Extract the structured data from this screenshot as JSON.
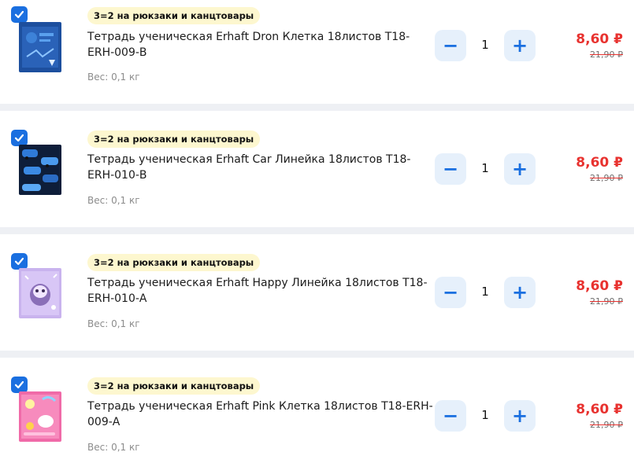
{
  "cart_items": [
    {
      "promo": "3=2 на рюкзаки и канцтовары",
      "title": "Тетрадь ученическая Erhaft Dron Клетка 18листов Т18-ERH-009-В",
      "weight": "Вес: 0,1 кг",
      "quantity": "1",
      "price": "8,60 ₽",
      "old_price": "21,90 ₽",
      "thumbnail": "notebook-blue-drone-cover",
      "checked": true
    },
    {
      "promo": "3=2 на рюкзаки и канцтовары",
      "title": "Тетрадь ученическая Erhaft Car Линейка 18листов Т18-ERH-010-В",
      "weight": "Вес: 0,1 кг",
      "quantity": "1",
      "price": "8,60 ₽",
      "old_price": "21,90 ₽",
      "thumbnail": "notebook-dark-cars-cover",
      "checked": true
    },
    {
      "promo": "3=2 на рюкзаки и канцтовары",
      "title": "Тетрадь ученическая Erhaft Happy Линейка 18листов Т18-ERH-010-А",
      "weight": "Вес: 0,1 кг",
      "quantity": "1",
      "price": "8,60 ₽",
      "old_price": "21,90 ₽",
      "thumbnail": "notebook-lilac-sloth-cover",
      "checked": true
    },
    {
      "promo": "3=2 на рюкзаки и канцтовары",
      "title": "Тетрадь ученическая Erhaft Pink Клетка 18листов Т18-ERH-009-А",
      "weight": "Вес: 0,1 кг",
      "quantity": "1",
      "price": "8,60 ₽",
      "old_price": "21,90 ₽",
      "thumbnail": "notebook-pink-unicorn-cover",
      "checked": true
    }
  ],
  "controls": {
    "minus_symbol": "−",
    "plus_symbol": "+"
  },
  "colors": {
    "accent": "#1a6fe0",
    "price": "#e8322f",
    "promo_bg": "#fdf7cf"
  }
}
